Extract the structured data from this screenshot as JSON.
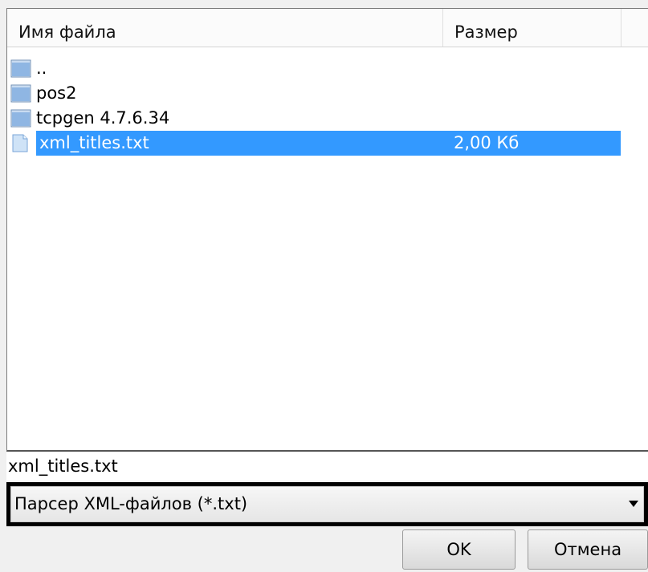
{
  "columns": {
    "name": "Имя файла",
    "size": "Размер"
  },
  "files": [
    {
      "icon": "folder-icon",
      "name": "..",
      "size": ""
    },
    {
      "icon": "folder-icon",
      "name": "pos2",
      "size": ""
    },
    {
      "icon": "folder-icon",
      "name": "tcpgen 4.7.6.34",
      "size": ""
    },
    {
      "icon": "text-file-icon",
      "name": "xml_titles.txt",
      "size": "2,00 Кб",
      "selected": true
    }
  ],
  "filename_field": {
    "value": "xml_titles.txt"
  },
  "filter": {
    "selected": "Парсер XML-файлов (*.txt)"
  },
  "buttons": {
    "ok": "OK",
    "cancel": "Отмена"
  },
  "colors": {
    "selection": "#3399ff",
    "folder": "#7aa6d8"
  }
}
